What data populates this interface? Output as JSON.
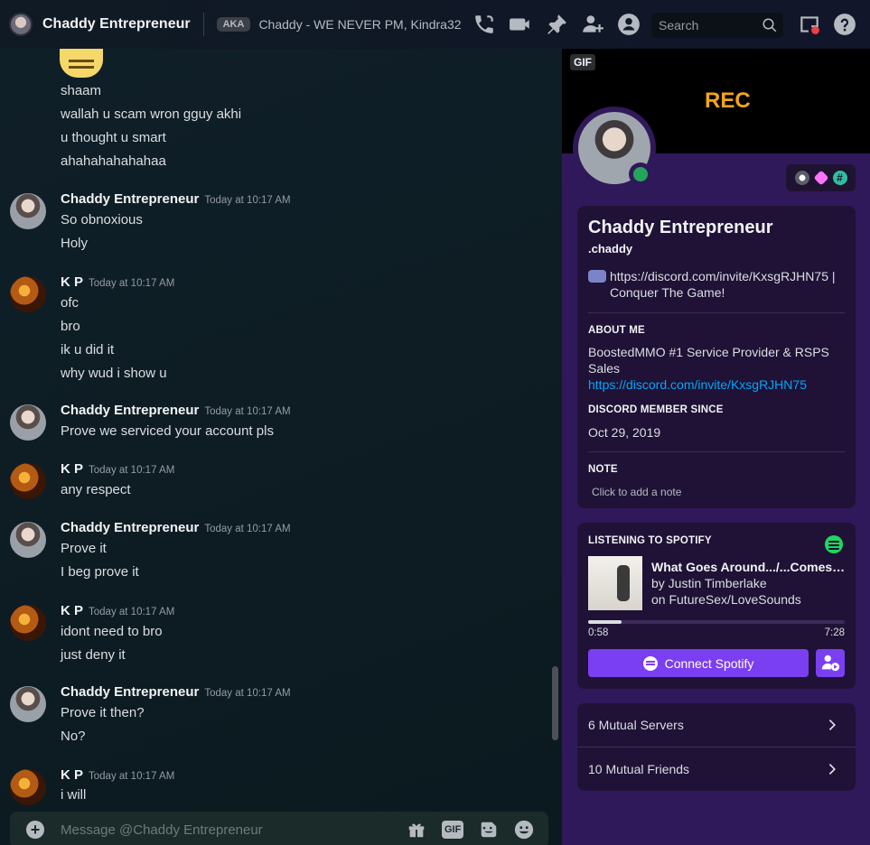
{
  "header": {
    "title": "Chaddy Entrepreneur",
    "aka_label": "AKA",
    "aka_names": "Chaddy - WE NEVER PM, Kindra32",
    "search_placeholder": "Search",
    "icons": [
      "phone-call-icon",
      "video-call-icon",
      "pin-icon",
      "add-friend-icon",
      "profile-toggle-icon",
      "search-icon",
      "inbox-icon",
      "help-icon"
    ]
  },
  "messages": [
    {
      "author": "",
      "time": "",
      "lines": [
        "shaam",
        "wallah u scam wron gguy akhi",
        "u thought u smart",
        "ahahahahahahaa"
      ]
    },
    {
      "author": "Chaddy Entrepreneur",
      "time": "Today at 10:17 AM",
      "lines": [
        "So obnoxious",
        "Holy"
      ]
    },
    {
      "author": "K P",
      "time": "Today at 10:17 AM",
      "lines": [
        "ofc",
        "bro",
        "ik u did it",
        "why wud i show u"
      ]
    },
    {
      "author": "Chaddy Entrepreneur",
      "time": "Today at 10:17 AM",
      "lines": [
        "Prove we serviced your account pls"
      ]
    },
    {
      "author": "K P",
      "time": "Today at 10:17 AM",
      "lines": [
        "any respect"
      ]
    },
    {
      "author": "Chaddy Entrepreneur",
      "time": "Today at 10:17 AM",
      "lines": [
        "Prove it",
        "I beg prove it"
      ]
    },
    {
      "author": "K P",
      "time": "Today at 10:17 AM",
      "lines": [
        "idont need to bro",
        "just deny it"
      ]
    },
    {
      "author": "Chaddy Entrepreneur",
      "time": "Today at 10:17 AM",
      "lines": [
        "Prove it then?",
        "No?"
      ]
    },
    {
      "author": "K P",
      "time": "Today at 10:17 AM",
      "lines": [
        "i will"
      ]
    }
  ],
  "composer": {
    "placeholder": "Message @Chaddy Entrepreneur",
    "gif_label": "GIF"
  },
  "profile": {
    "banner_gif_tag": "GIF",
    "banner_text": "REC",
    "display_name": "Chaddy Entrepreneur",
    "username": ".chaddy",
    "custom_status": "https://discord.com/invite/KxsgRJHN75 | Conquer The Game!",
    "about_heading": "ABOUT ME",
    "about_text": "BoostedMMO #1 Service Provider & RSPS Sales",
    "about_link": "https://discord.com/invite/KxsgRJHN75",
    "member_since_heading": "DISCORD MEMBER SINCE",
    "member_since": "Oct 29, 2019",
    "note_heading": "NOTE",
    "note_placeholder": "Click to add a note",
    "status_color": "#23a55a"
  },
  "spotify": {
    "heading": "LISTENING TO SPOTIFY",
    "track": "What Goes Around.../...Comes Around (Interlude)",
    "artist": "by Justin Timberlake",
    "album": "on FutureSex/LoveSounds",
    "elapsed": "0:58",
    "duration": "7:28",
    "progress": 0.13,
    "connect_label": "Connect Spotify",
    "accent": "#7b3ff2"
  },
  "mutuals": {
    "servers": "6 Mutual Servers",
    "friends": "10 Mutual Friends"
  }
}
